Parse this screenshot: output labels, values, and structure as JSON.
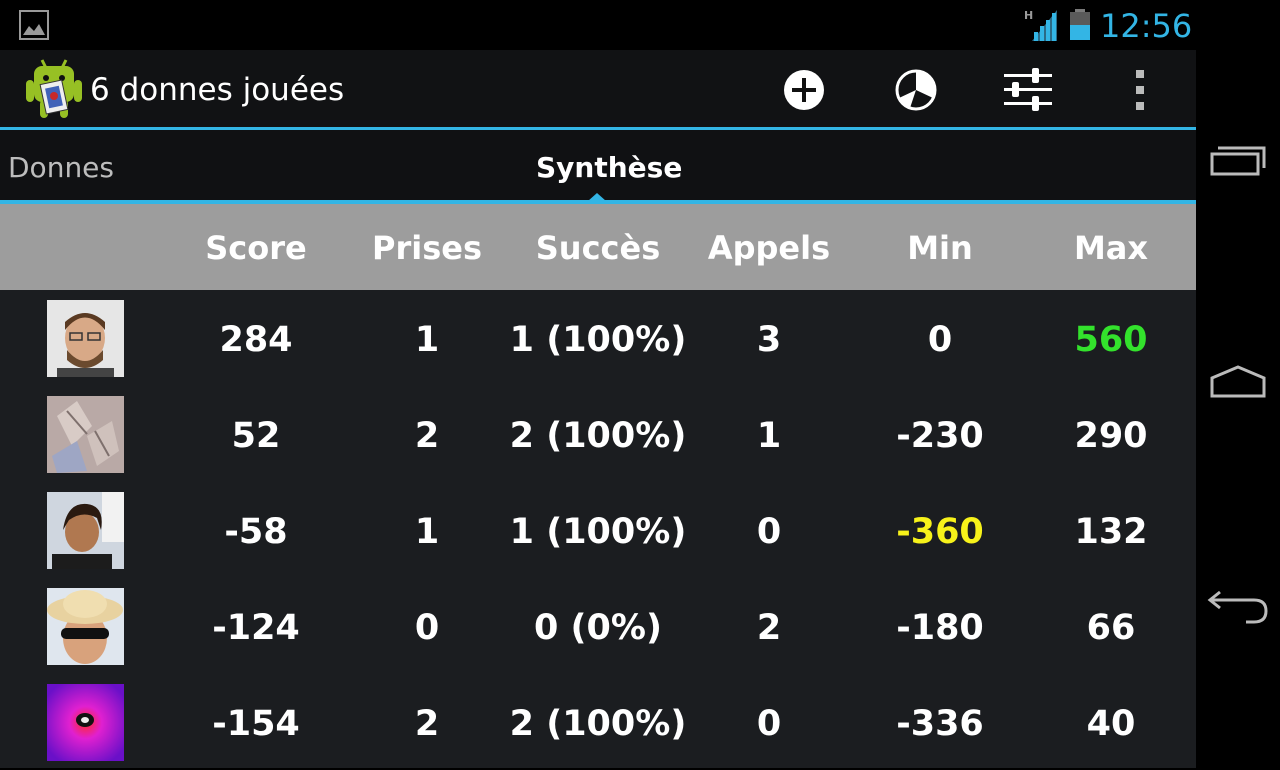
{
  "status_bar": {
    "time": "12:56",
    "network_label": "H",
    "icons": [
      "image-notification-icon",
      "signal-icon",
      "battery-icon"
    ]
  },
  "action_bar": {
    "title": "6 donnes jouées",
    "icons": [
      "app-logo-icon",
      "add-icon",
      "pie-chart-icon",
      "settings-sliders-icon",
      "overflow-menu-icon"
    ]
  },
  "tabs": [
    {
      "label": "Donnes",
      "selected": false
    },
    {
      "label": "Synthèse",
      "selected": true
    }
  ],
  "table": {
    "headers": [
      "Score",
      "Prises",
      "Succès",
      "Appels",
      "Min",
      "Max"
    ],
    "rows": [
      {
        "avatar": "player-1-avatar",
        "score": "284",
        "prises": "1",
        "succes": "1 (100%)",
        "appels": "3",
        "min": "0",
        "max": "560"
      },
      {
        "avatar": "player-2-avatar",
        "score": "52",
        "prises": "2",
        "succes": "2 (100%)",
        "appels": "1",
        "min": "-230",
        "max": "290"
      },
      {
        "avatar": "player-3-avatar",
        "score": "-58",
        "prises": "1",
        "succes": "1 (100%)",
        "appels": "0",
        "min": "-360",
        "max": "132"
      },
      {
        "avatar": "player-4-avatar",
        "score": "-124",
        "prises": "0",
        "succes": "0 (0%)",
        "appels": "2",
        "min": "-180",
        "max": "66"
      },
      {
        "avatar": "player-5-avatar",
        "score": "-154",
        "prises": "2",
        "succes": "2 (100%)",
        "appels": "0",
        "min": "-336",
        "max": "40"
      }
    ],
    "highlight_colors": {
      "best_max": "#33e22c",
      "worst_min": "#f7f21a"
    }
  },
  "colors": {
    "accent": "#33b5e5",
    "header_bg": "#9d9d9d",
    "row_bg": "#1b1d20"
  },
  "nav_bar": {
    "icons": [
      "recent-apps-icon",
      "home-icon",
      "back-icon"
    ]
  }
}
